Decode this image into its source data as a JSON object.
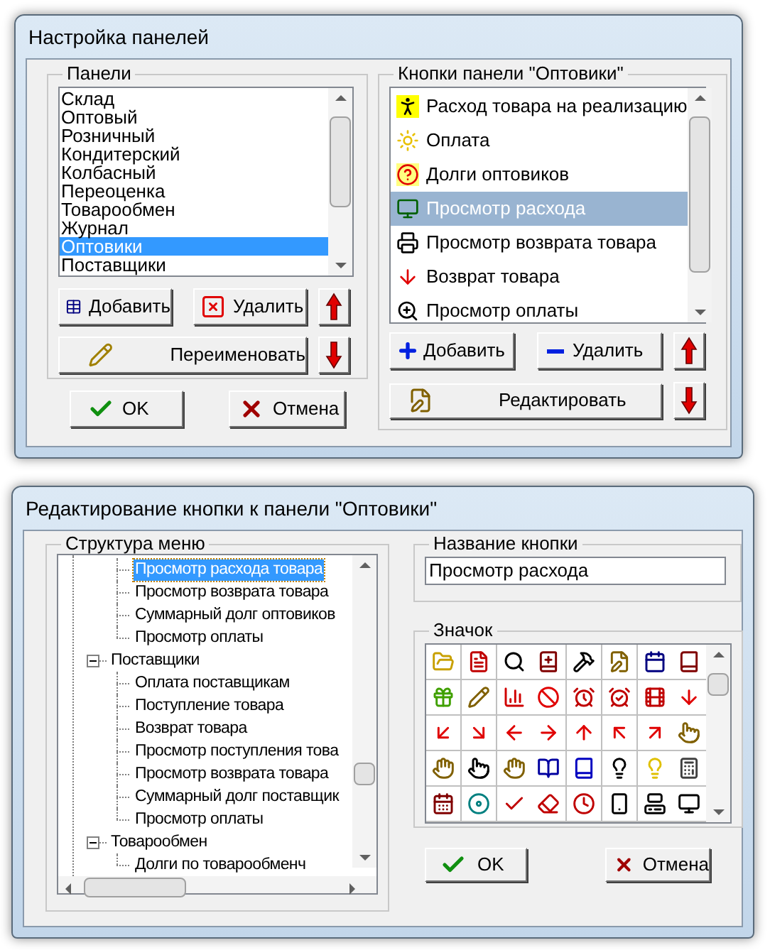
{
  "panels_dialog": {
    "title": "Настройка панелей",
    "panels_group": {
      "title": "Панели",
      "items": [
        {
          "label": "Склад",
          "selected": false
        },
        {
          "label": "Оптовый",
          "selected": false
        },
        {
          "label": "Розничный",
          "selected": false
        },
        {
          "label": "Кондитерский",
          "selected": false
        },
        {
          "label": "Колбасный",
          "selected": false
        },
        {
          "label": "Переоценка",
          "selected": false
        },
        {
          "label": "Товарообмен",
          "selected": false
        },
        {
          "label": "Журнал",
          "selected": false
        },
        {
          "label": "Оптовики",
          "selected": true
        },
        {
          "label": "Поставщики",
          "selected": false
        }
      ],
      "add_button": "Добавить",
      "delete_button": "Удалить",
      "rename_button": "Переименовать"
    },
    "buttons_group": {
      "title": "Кнопки панели \"Оптовики\"",
      "items": [
        {
          "label": "Расход товара на реализацию",
          "selected": false
        },
        {
          "label": "Оплата",
          "selected": false
        },
        {
          "label": "Долги оптовиков",
          "selected": false
        },
        {
          "label": "Просмотр расхода",
          "selected": true
        },
        {
          "label": "Просмотр возврата товара",
          "selected": false
        },
        {
          "label": "Возврат товара",
          "selected": false
        },
        {
          "label": "Просмотр оплаты",
          "selected": false
        }
      ],
      "add_button": "Добавить",
      "delete_button": "Удалить",
      "edit_button": "Редактировать"
    },
    "ok_button": "OK",
    "cancel_button": "Отмена"
  },
  "edit_dialog": {
    "title": "Редактирование кнопки к панели \"Оптовики\"",
    "menu_group": {
      "title": "Структура меню",
      "partial_children": [
        {
          "label": "Просмотр расхода товара",
          "selected": true
        },
        {
          "label": "Просмотр возврата товара",
          "selected": false
        },
        {
          "label": "Суммарный долг оптовиков",
          "selected": false
        },
        {
          "label": "Просмотр оплаты",
          "selected": false
        }
      ],
      "nodes": [
        {
          "label": "Поставщики",
          "selected": false,
          "expanded": true,
          "children": [
            {
              "label": "Оплата поставщикам",
              "selected": false
            },
            {
              "label": "Поступление товара",
              "selected": false
            },
            {
              "label": "Возврат товара",
              "selected": false
            },
            {
              "label": "Просмотр поступления това",
              "selected": false
            },
            {
              "label": "Просмотр возврата товара",
              "selected": false
            },
            {
              "label": "Суммарный долг поставщик",
              "selected": false
            },
            {
              "label": "Просмотр оплаты",
              "selected": false
            }
          ]
        },
        {
          "label": "Товарообмен",
          "selected": false,
          "expanded": true,
          "children": [
            {
              "label": "Долги по товарообменч",
              "selected": false
            }
          ]
        }
      ]
    },
    "name_group": {
      "title": "Название кнопки",
      "value": "Просмотр расхода"
    },
    "icon_group": {
      "title": "Значок"
    },
    "ok_button": "OK",
    "cancel_button": "Отмена"
  }
}
